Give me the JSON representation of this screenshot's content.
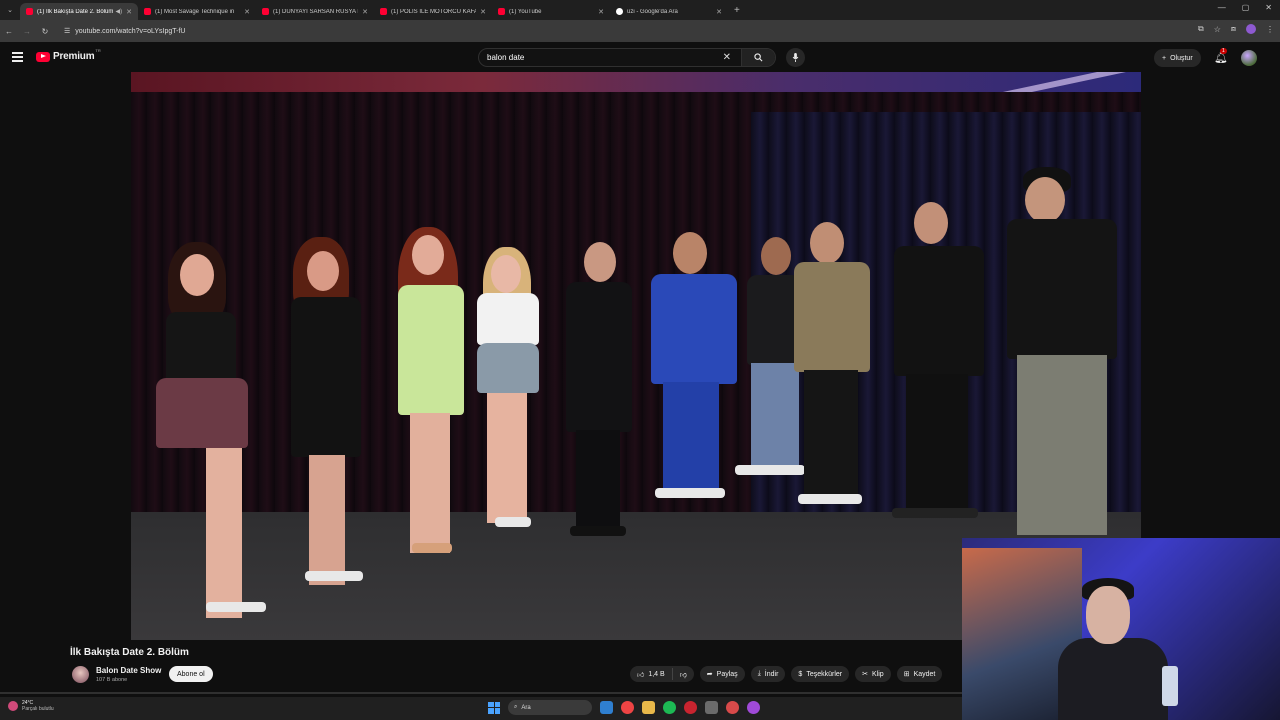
{
  "browser": {
    "tabs": [
      {
        "title": "(1) İlk Bakışta Date 2. Bölüm",
        "active": true,
        "favicon": "youtube-icon"
      },
      {
        "title": "(1) Most Savage Technique in",
        "active": false,
        "favicon": "youtube-icon"
      },
      {
        "title": "(1) DÜNYAYI SARSAN RUSYA D",
        "active": false,
        "favicon": "youtube-icon"
      },
      {
        "title": "(1) POLİS İLE MOTORCU KAFA",
        "active": false,
        "favicon": "youtube-icon"
      },
      {
        "title": "(1) YouTube",
        "active": false,
        "favicon": "youtube-icon"
      },
      {
        "title": "üzi - Google'da Ara",
        "active": false,
        "favicon": "google-icon"
      }
    ],
    "url": "youtube.com/watch?v=oLYsIpgT-fU"
  },
  "youtube": {
    "logo_text": "Premium",
    "country_code": "TR",
    "search_value": "balon date",
    "create_label": "Oluştur",
    "notification_count": "1"
  },
  "video": {
    "title": "İlk Bakışta Date 2. Bölüm",
    "channel_name": "Balon Date Show",
    "subscribers": "107 B abone",
    "subscribe_label": "Abone ol",
    "likes": "1,4 B",
    "share_label": "Paylaş",
    "download_label": "İndir",
    "thanks_label": "Teşekkürler",
    "clip_label": "Klip",
    "save_label": "Kaydet"
  },
  "taskbar": {
    "temperature": "24°C",
    "weather_text": "Parçalı bulutlu",
    "search_label": "Ara"
  },
  "colors": {
    "youtube_red": "#ff0033",
    "background": "#0f0f0f"
  }
}
